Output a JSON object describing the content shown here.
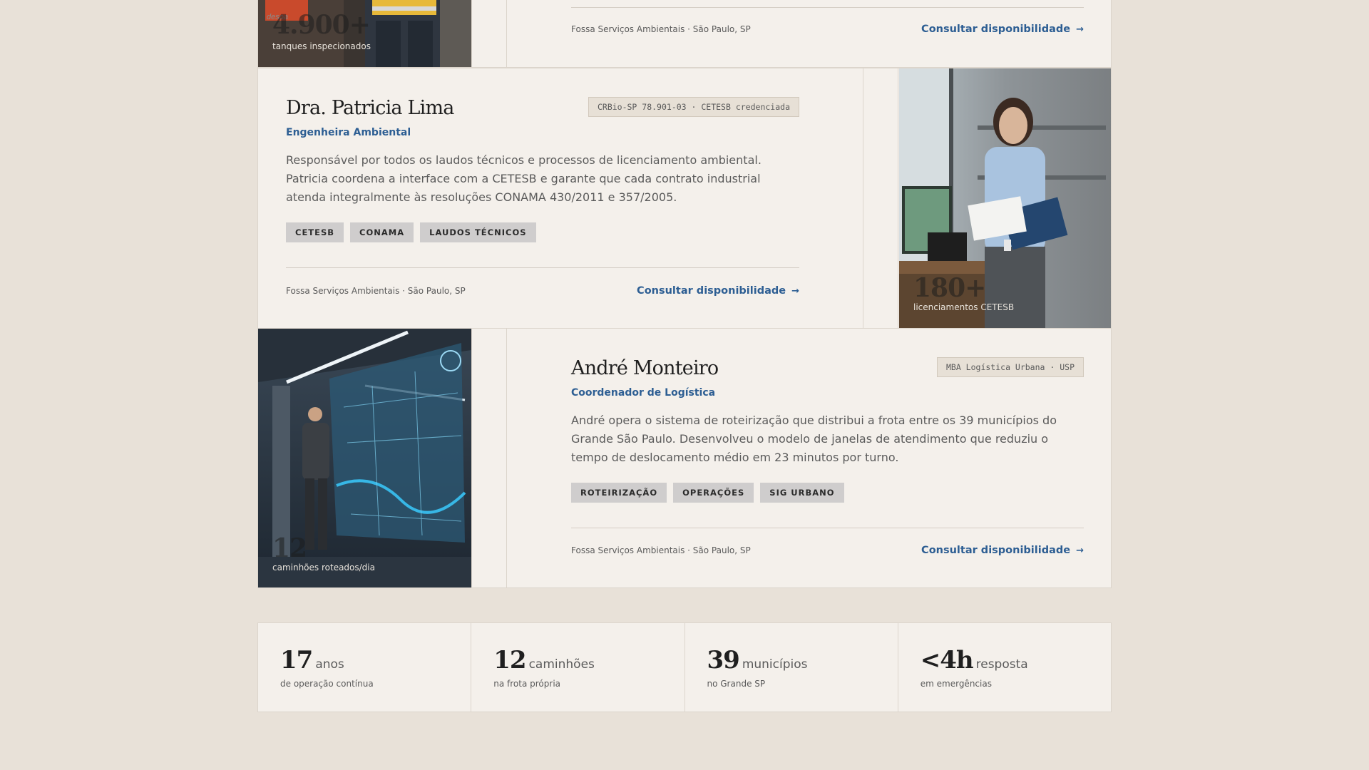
{
  "cards": [
    {
      "photo_stat": {
        "value": "4.900+",
        "label": "tanques inspecionados"
      },
      "company": "Fossa Serviços Ambientais · São Paulo, SP",
      "cta": "Consultar disponibilidade"
    },
    {
      "name": "Dra. Patricia Lima",
      "role": "Engenheira Ambiental",
      "credential": "CRBio-SP 78.901-03 · CETESB credenciada",
      "description": "Responsável por todos os laudos técnicos e processos de licenciamento ambiental. Patricia coordena a interface com a CETESB e garante que cada contrato industrial atenda integralmente às resoluções CONAMA 430/2011 e 357/2005.",
      "tags": [
        "CETESB",
        "CONAMA",
        "LAUDOS TÉCNICOS"
      ],
      "company": "Fossa Serviços Ambientais · São Paulo, SP",
      "cta": "Consultar disponibilidade",
      "photo_stat": {
        "value": "180+",
        "label": "licenciamentos CETESB"
      }
    },
    {
      "name": "André Monteiro",
      "role": "Coordenador de Logística",
      "credential": "MBA Logística Urbana · USP",
      "description": "André opera o sistema de roteirização que distribui a frota entre os 39 municípios do Grande São Paulo. Desenvolveu o modelo de janelas de atendimento que reduziu o tempo de deslocamento médio em 23 minutos por turno.",
      "tags": [
        "ROTEIRIZAÇÃO",
        "OPERAÇÕES",
        "SIG URBANO"
      ],
      "company": "Fossa Serviços Ambientais · São Paulo, SP",
      "cta": "Consultar disponibilidade",
      "photo_stat": {
        "value": "12",
        "label": "caminhões roteados/dia"
      }
    }
  ],
  "stats": [
    {
      "value": "17",
      "unit": "anos",
      "sub": "de operação contínua"
    },
    {
      "value": "12",
      "unit": "caminhões",
      "sub": "na frota própria"
    },
    {
      "value": "39",
      "unit": "municípios",
      "sub": "no Grande SP"
    },
    {
      "value": "<4h",
      "unit": "resposta",
      "sub": "em emergências"
    }
  ],
  "icons": {
    "arrow": "→"
  }
}
